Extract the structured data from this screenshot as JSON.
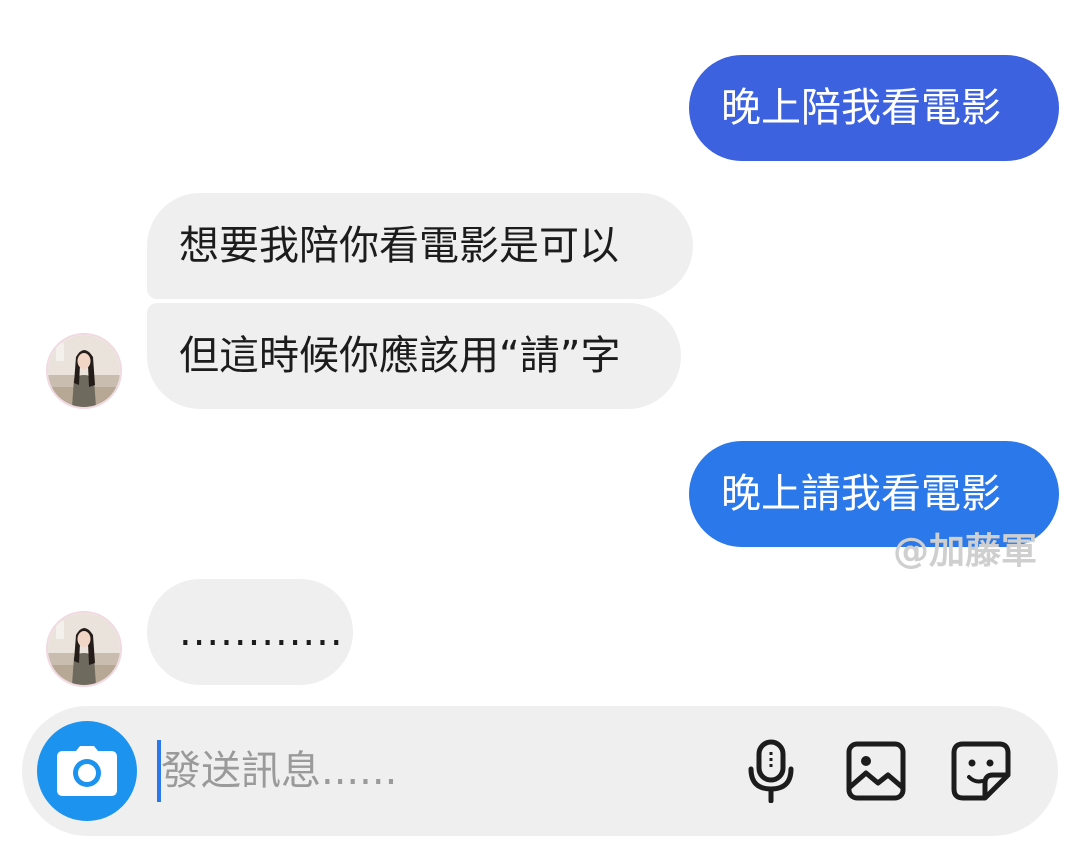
{
  "messages": [
    {
      "id": "b1",
      "direction": "outgoing",
      "text": "晚上陪我看電影",
      "color": "#3d62e0"
    },
    {
      "id": "b2",
      "direction": "incoming",
      "text": "想要我陪你看電影是可以"
    },
    {
      "id": "b3",
      "direction": "incoming",
      "text": "但這時候你應該用“請”字"
    },
    {
      "id": "b4",
      "direction": "outgoing",
      "text": "晚上請我看電影",
      "color": "#2b78ea"
    },
    {
      "id": "b5",
      "direction": "incoming",
      "text": "............"
    }
  ],
  "watermark": "@加藤軍",
  "composer": {
    "placeholder": "發送訊息......",
    "value": "",
    "icons": [
      "camera-icon",
      "microphone-icon",
      "image-icon",
      "sticker-icon"
    ],
    "camera_color": "#1c93ef"
  },
  "avatar_icon": "contact-avatar"
}
